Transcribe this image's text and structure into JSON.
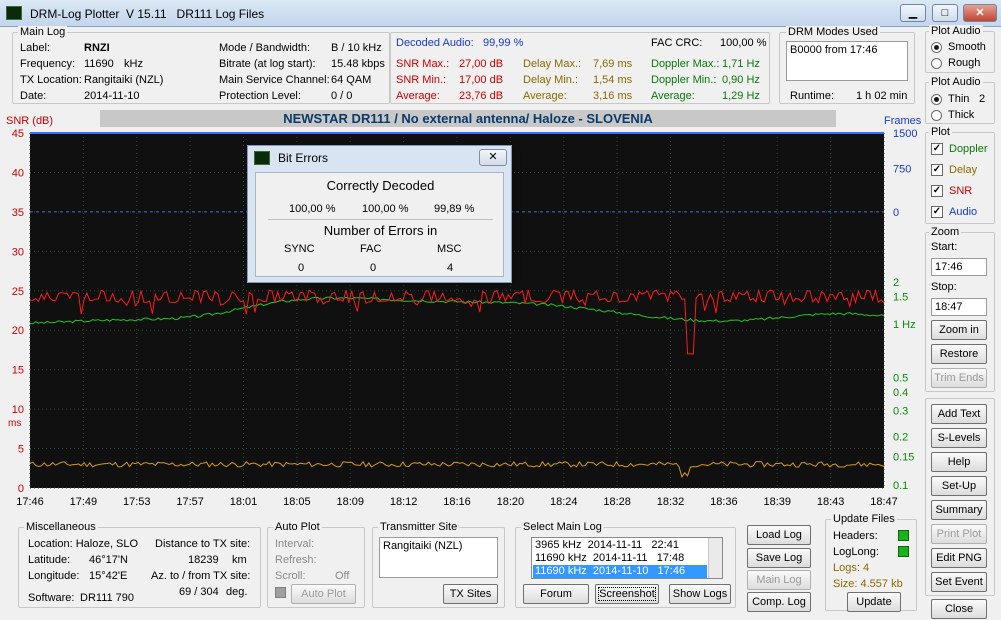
{
  "window": {
    "app_name": "DRM-Log Plotter",
    "version": "V 15.11",
    "file_label": "DR111 Log Files",
    "minimize": "▁",
    "maximize": "□",
    "close": "✕"
  },
  "main_log": {
    "title": "Main Log",
    "label_k": "Label:",
    "label_v": "RNZI",
    "freq_k": "Frequency:",
    "freq_v": "11690",
    "freq_u": "kHz",
    "tx_k": "TX Location:",
    "tx_v": "Rangitaiki (NZL)",
    "date_k": "Date:",
    "date_v": "2014-11-10",
    "mode_k": "Mode / Bandwidth:",
    "mode_v": "B / 10 kHz",
    "bitrate_k": "Bitrate (at log start):",
    "bitrate_v": "15.48 kbps",
    "msc_k": "Main Service Channel:",
    "msc_v": "64  QAM",
    "prot_k": "Protection Level:",
    "prot_v": "0 / 0"
  },
  "stats": {
    "decoded_k": "Decoded Audio:",
    "decoded_v": "99,99 %",
    "fac_k": "FAC  CRC:",
    "fac_v": "100,00 %",
    "snr_max_k": "SNR Max.:",
    "snr_max_v": "27,00  dB",
    "snr_min_k": "SNR Min.:",
    "snr_min_v": "17,00  dB",
    "snr_avg_k": "Average:",
    "snr_avg_v": "23,76  dB",
    "delay_max_k": "Delay Max.:",
    "delay_max_v": "7,69   ms",
    "delay_min_k": "Delay Min.:",
    "delay_min_v": "1,54   ms",
    "delay_avg_k": "Average:",
    "delay_avg_v": "3,16   ms",
    "dop_max_k": "Doppler Max.:",
    "dop_max_v": "1,71 Hz",
    "dop_min_k": "Doppler Min.:",
    "dop_min_v": "0,90 Hz",
    "dop_avg_k": "Average:",
    "dop_avg_v": "1,29 Hz"
  },
  "drm_modes": {
    "title": "DRM Modes Used",
    "entry": "B0000 from 17:46",
    "runtime_k": "Runtime:",
    "runtime_v": "1 h 02 min"
  },
  "plot_audio": {
    "title": "Plot Audio",
    "smooth": "Smooth",
    "rough": "Rough"
  },
  "plot_audio2": {
    "title": "Plot Audio",
    "thin": "Thin",
    "thin_n": "2",
    "thick": "Thick"
  },
  "plot_sel": {
    "title": "Plot",
    "doppler": "Doppler",
    "delay": "Delay",
    "snr": "SNR",
    "audio": "Audio",
    "check": "✓"
  },
  "zoom": {
    "title": "Zoom",
    "start_k": "Start:",
    "start_v": "17:46",
    "stop_k": "Stop:",
    "stop_v": "18:47",
    "zoom_in": "Zoom in",
    "restore": "Restore",
    "trim": "Trim Ends"
  },
  "side_buttons": {
    "add_text": "Add Text",
    "s_levels": "S-Levels",
    "help": "Help",
    "setup": "Set-Up",
    "summary": "Summary",
    "print": "Print Plot",
    "edit_png": "Edit PNG",
    "set_event": "Set Event",
    "close": "Close"
  },
  "chart_data": {
    "type": "line",
    "title": "NEWSTAR DR111 / No external antenna/ Haloze - SLOVENIA",
    "left_axis_label": "SNR (dB)",
    "left_axis2_label": "ms",
    "right_axis_label": "Frames",
    "x_ticks": [
      "17:46",
      "17:49",
      "17:53",
      "17:57",
      "18:01",
      "18:05",
      "18:09",
      "18:12",
      "18:16",
      "18:20",
      "18:24",
      "18:28",
      "18:32",
      "18:36",
      "18:39",
      "18:43",
      "18:47"
    ],
    "y_ticks": [
      45,
      40,
      35,
      30,
      25,
      20,
      15,
      10,
      5,
      0
    ],
    "right_top_ticks": [
      "1500",
      "750",
      "0"
    ],
    "right_bottom_ticks": [
      "2",
      "1.5",
      "1 Hz",
      "0.5",
      "0.4",
      "0.3",
      "0.2",
      "0.15",
      "0.1"
    ],
    "ylim": [
      0,
      45
    ],
    "grid": true,
    "series": [
      {
        "name": "SNR",
        "color": "#ff1a1a",
        "summary": {
          "max": 27.0,
          "min": 17.0,
          "avg": 23.76
        }
      },
      {
        "name": "Doppler",
        "color": "#22c422",
        "summary": {
          "max": 1.71,
          "min": 0.9,
          "avg": 1.29
        }
      },
      {
        "name": "Delay",
        "color": "#d49a1a",
        "summary": {
          "max": 7.69,
          "min": 1.54,
          "avg": 3.16
        }
      },
      {
        "name": "Audio",
        "color": "#3a6aff",
        "summary": {
          "decoded_pct": 99.99
        }
      }
    ]
  },
  "bit_errors": {
    "title": "Bit Errors",
    "close": "✕",
    "correct": "Correctly Decoded",
    "c1": "100,00 %",
    "c2": "100,00 %",
    "c3": "99,89 %",
    "errors": "Number of Errors in",
    "h1": "SYNC",
    "h2": "FAC",
    "h3": "MSC",
    "v1": "0",
    "v2": "0",
    "v3": "4"
  },
  "misc": {
    "title": "Miscellaneous",
    "loc": "Location: Haloze, SLO",
    "lat_k": "Latitude:",
    "lat_v": "46°17'N",
    "lon_k": "Longitude:",
    "lon_v": "15°42'E",
    "soft_k": "Software:",
    "soft_v": "DR111 790",
    "dist_k": "Distance to TX site:",
    "dist_v": "18239",
    "dist_u": "km",
    "az_k": "Az. to / from TX site:",
    "az_v": "69 / 304",
    "az_u": "deg."
  },
  "auto_plot": {
    "title": "Auto Plot",
    "interval": "Interval:",
    "refresh": "Refresh:",
    "scroll": "Scroll:",
    "scroll_v": "Off",
    "btn": "Auto Plot"
  },
  "tx_site": {
    "title": "Transmitter Site",
    "entry": "Rangitaiki (NZL)",
    "btn": "TX Sites"
  },
  "select_log": {
    "title": "Select Main Log",
    "items": [
      {
        "freq": "3965 kHz",
        "date": "2014-11-11",
        "time": "22:41"
      },
      {
        "freq": "11690 kHz",
        "date": "2014-11-11",
        "time": "17:48"
      },
      {
        "freq": "11690 kHz",
        "date": "2014-11-10",
        "time": "17:46"
      }
    ],
    "forum": "Forum",
    "screenshot": "Screenshot",
    "show_logs": "Show Logs"
  },
  "log_buttons": {
    "load": "Load Log",
    "save": "Save Log",
    "main": "Main Log",
    "comp": "Comp. Log"
  },
  "update": {
    "title": "Update Files",
    "headers": "Headers:",
    "loglong": "LogLong:",
    "logs": "Logs: 4",
    "size": "Size:  4.557 kb",
    "btn": "Update"
  }
}
